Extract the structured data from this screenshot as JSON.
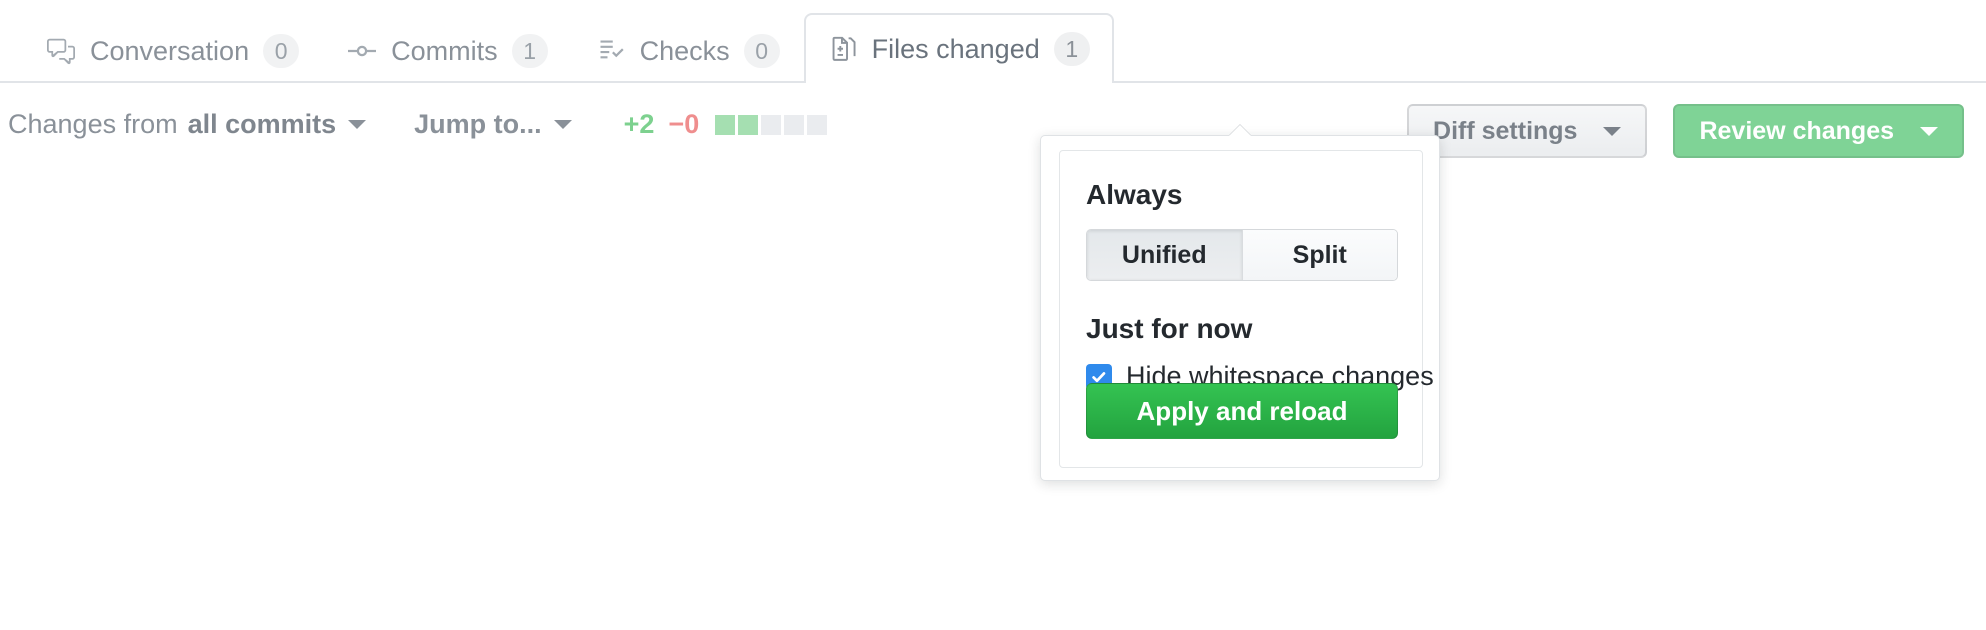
{
  "tabs": [
    {
      "label": "Conversation",
      "count": "0",
      "icon": "comment-discussion-icon",
      "active": false
    },
    {
      "label": "Commits",
      "count": "1",
      "icon": "git-commit-icon",
      "active": false
    },
    {
      "label": "Checks",
      "count": "0",
      "icon": "checklist-icon",
      "active": false
    },
    {
      "label": "Files changed",
      "count": "1",
      "icon": "file-diff-icon",
      "active": true
    }
  ],
  "toolbar": {
    "changes_from_prefix": "Changes from",
    "changes_from_value": "all commits",
    "jump_to_label": "Jump to...",
    "diffstat": {
      "added": "+2",
      "deleted": "−0",
      "blocks_on": 2,
      "blocks_off": 3
    },
    "diff_settings_label": "Diff settings",
    "review_changes_label": "Review changes"
  },
  "dropdown": {
    "always_title": "Always",
    "view_modes": [
      {
        "label": "Unified",
        "selected": true
      },
      {
        "label": "Split",
        "selected": false
      }
    ],
    "just_for_now_title": "Just for now",
    "hide_whitespace_label": "Hide whitespace changes",
    "hide_whitespace_checked": true,
    "apply_label": "Apply and reload"
  },
  "colors": {
    "added_green": "#7dd18f",
    "deleted_red": "#ef8e8e",
    "diffstat_block": "#a5dfb1",
    "diffstat_block_empty": "#eaecef",
    "primary_green": "#7fd396",
    "apply_green": "#23a33f",
    "checkbox_blue": "#2f8aec",
    "border_gray": "#e1e4e8",
    "muted_text": "#8a9199"
  }
}
